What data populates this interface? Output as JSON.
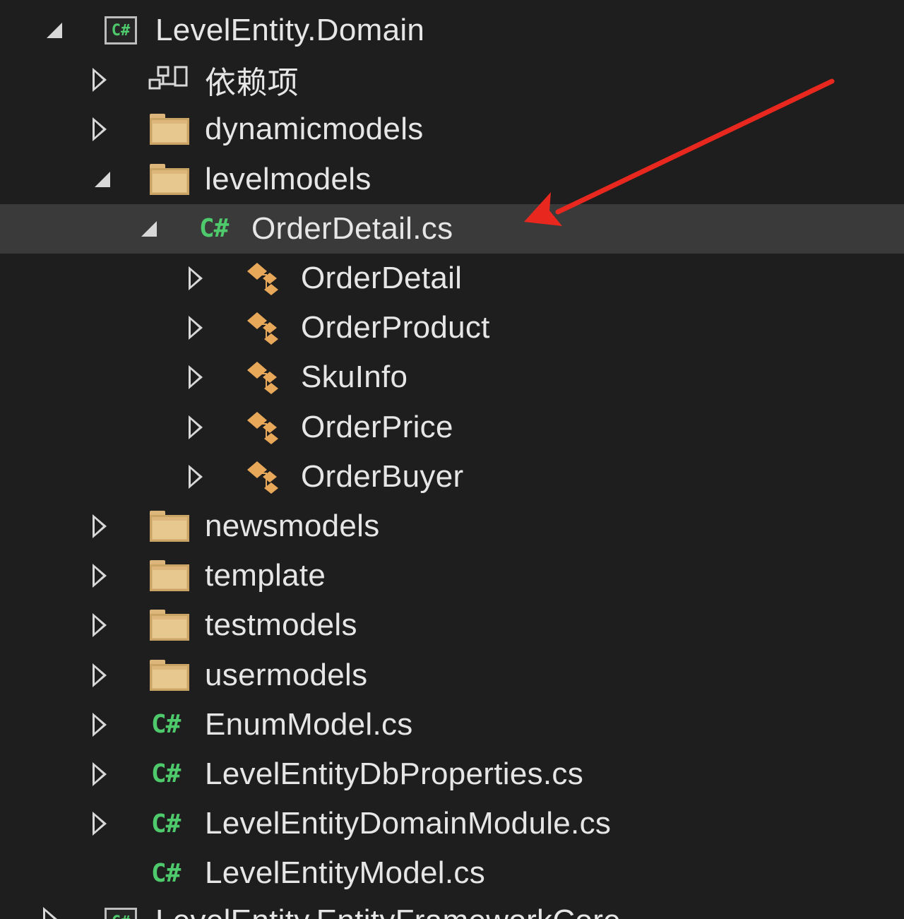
{
  "tree": {
    "project": {
      "label": "LevelEntity.Domain",
      "icon": "csharp-project-icon"
    },
    "dependencies": {
      "label": "依赖项",
      "icon": "dependencies-icon"
    },
    "folders_top": [
      {
        "label": "dynamicmodels",
        "icon": "folder-icon"
      },
      {
        "label": "levelmodels",
        "icon": "folder-icon"
      }
    ],
    "selected_file": {
      "label": "OrderDetail.cs",
      "icon_text": "C#"
    },
    "classes": [
      {
        "label": "OrderDetail"
      },
      {
        "label": "OrderProduct"
      },
      {
        "label": "SkuInfo"
      },
      {
        "label": "OrderPrice"
      },
      {
        "label": "OrderBuyer"
      }
    ],
    "folders_bottom": [
      {
        "label": "newsmodels"
      },
      {
        "label": "template"
      },
      {
        "label": "testmodels"
      },
      {
        "label": "usermodels"
      }
    ],
    "files": [
      {
        "label": "EnumModel.cs",
        "icon_text": "C#"
      },
      {
        "label": "LevelEntityDbProperties.cs",
        "icon_text": "C#"
      },
      {
        "label": "LevelEntityDomainModule.cs",
        "icon_text": "C#"
      },
      {
        "label": "LevelEntityModel.cs",
        "icon_text": "C#"
      }
    ],
    "next_project": {
      "label": "LevelEntity.EntityFrameworkCore"
    }
  },
  "colors": {
    "background": "#1e1e1e",
    "selected_row": "#3a3a3a",
    "csharp_green": "#4ec96b",
    "folder": "#dcb67a",
    "class_icon": "#e8a85a",
    "annotation_arrow": "#e8281e"
  },
  "annotation": {
    "type": "arrow",
    "points_to": "OrderDetail.cs"
  }
}
